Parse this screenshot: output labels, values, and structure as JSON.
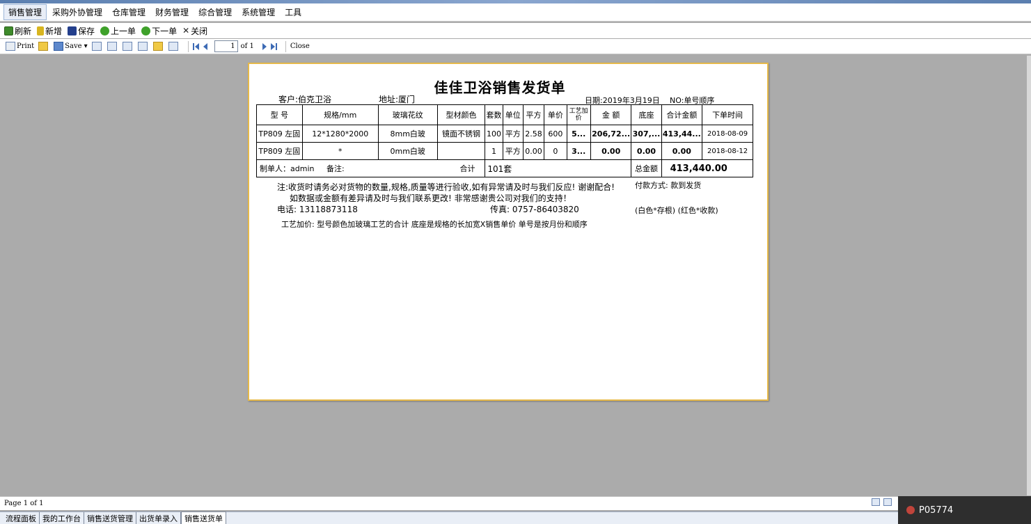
{
  "menu": [
    "销售管理",
    "采购外协管理",
    "仓库管理",
    "财务管理",
    "综合管理",
    "系统管理",
    "工具"
  ],
  "toolbar": {
    "refresh": "刷新",
    "new": "新增",
    "save": "保存",
    "prev": "上一单",
    "next": "下一单",
    "close": "关闭"
  },
  "report_toolbar": {
    "print": "Print",
    "save": "Save",
    "page_value": "1",
    "of_pages": "of 1",
    "close": "Close"
  },
  "document": {
    "title": "佳佳卫浴销售发货单",
    "customer": "客户:伯克卫浴",
    "address": "地址:厦门",
    "date": "日期:2019年3月19日",
    "no": "NO:单号顺序",
    "headers": [
      "型 号",
      "规格/mm",
      "玻璃花纹",
      "型材颜色",
      "套数",
      "单位",
      "平方",
      "单价",
      "工艺加价",
      "金 额",
      "底座",
      "合计金额",
      "下单时间"
    ],
    "rows": [
      [
        "TP809 左固",
        "12*1280*2000",
        "8mm白玻",
        "镜面不锈钢",
        "100",
        "平方",
        "2.58",
        "600",
        "5...",
        "206,72...",
        "307,...",
        "413,44...",
        "2018-08-09"
      ],
      [
        "TP809 左固",
        "*",
        "0mm白玻",
        "",
        "1",
        "平方",
        "0.00",
        "0",
        "3...",
        "0.00",
        "0.00",
        "0.00",
        "2018-08-12"
      ]
    ],
    "maker": "制单人：admin",
    "remark": "备注:",
    "total_label": "合计",
    "total_sets": "101套",
    "grand_total_label": "总金额",
    "grand_total": "413,440.00",
    "note1": "注:收货时请务必对货物的数量,规格,质量等进行验收,如有异常请及时与我们反应! 谢谢配合!",
    "payment": "付款方式: 款到发货",
    "note2": "如数据或金额有差异请及时与我们联系更改!   非常感谢贵公司对我们的支持！",
    "phone": "电话: 13118873118",
    "fax": "传真: 0757-86403820",
    "copies": "(白色*存根)   (红色*收款)",
    "footnote": "工艺加价: 型号颜色加玻璃工艺的合计       底座是规格的长加宽X销售单价      单号是按月份和顺序"
  },
  "status": "Page 1 of 1",
  "tabs": [
    "流程面板",
    "我的工作台",
    "销售送货管理",
    "出货单录入",
    "销售送货单"
  ],
  "overlay_user": "P05774",
  "colors": {
    "paper_border": "#e6b94a",
    "viewer_bg": "#ababab",
    "active_menu": "#e9eef7"
  }
}
